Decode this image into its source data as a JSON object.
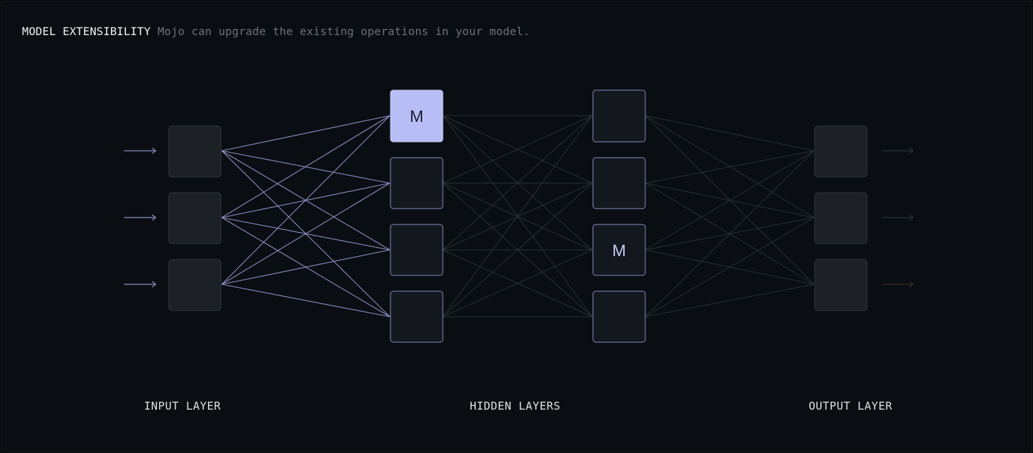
{
  "header": {
    "title": "MODEL EXTENSIBILITY",
    "description": "Mojo can upgrade the existing operations in your model."
  },
  "layers": {
    "input_label": "INPUT LAYER",
    "hidden_label": "HIDDEN LAYERS",
    "output_label": "OUTPUT LAYER"
  },
  "node_marker": "M",
  "colors": {
    "background": "#0a0e12",
    "accent": "#b9bdf5",
    "active_line": "#8e93c8",
    "dim_line": "#2a3236",
    "input_node": "#1d2125",
    "hidden_node": "#15171f",
    "hidden_border": "#8a8ec2"
  }
}
